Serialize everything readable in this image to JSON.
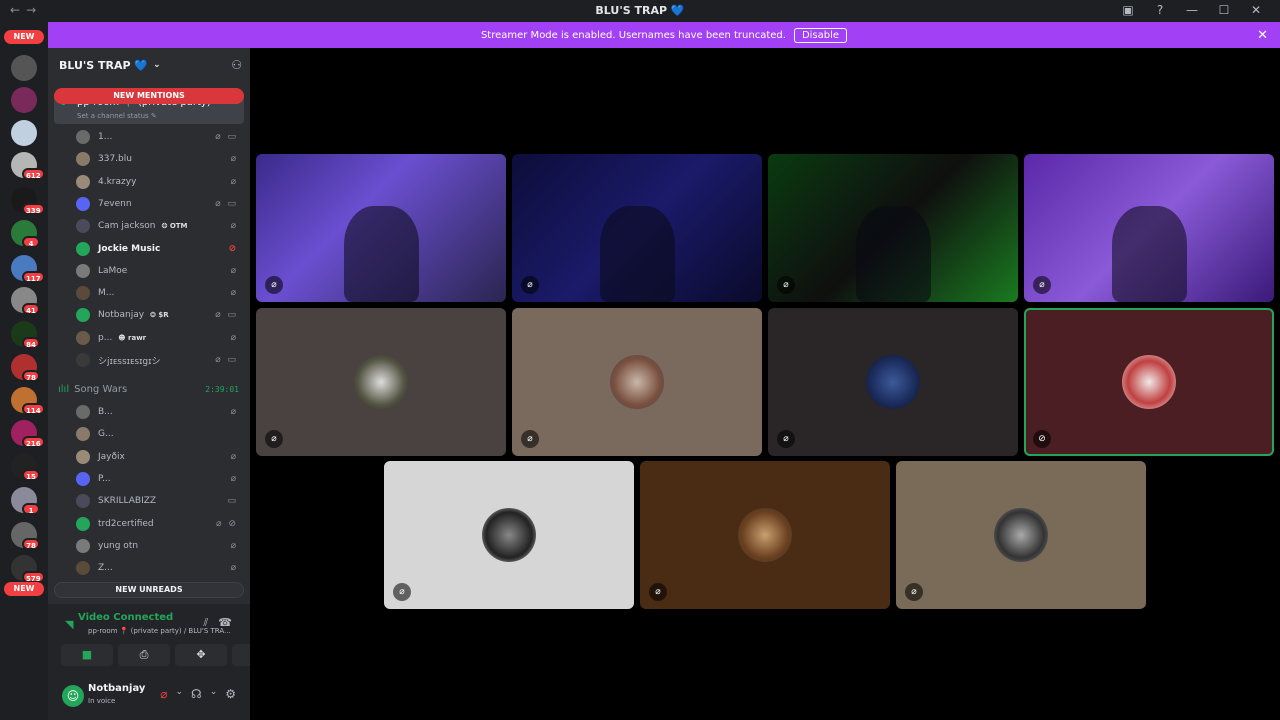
{
  "window": {
    "title": "BLU'S TRAP 💙",
    "nav_back": "←",
    "nav_fwd": "→"
  },
  "titlebar_icons": [
    "inbox-icon",
    "help-icon",
    "minimize-icon",
    "maximize-icon",
    "close-icon"
  ],
  "banner": {
    "text": "Streamer Mode is enabled. Usernames have been truncated.",
    "button": "Disable",
    "bg": "#a240f5"
  },
  "server_rail": {
    "top_pill": "NEW",
    "bottom_pill": "NEW",
    "badges": [
      "612",
      "339",
      "4",
      "117",
      "41",
      "84",
      "78",
      "114",
      "216",
      "15",
      "1",
      "78",
      "579"
    ]
  },
  "sidebar": {
    "server_name": "BLU'S TRAP 💙",
    "new_mentions": "NEW MENTIONS",
    "channel": {
      "name": "pp-room 📍 (private party)",
      "status": "Set a channel status ✎"
    },
    "members": [
      {
        "name": "1...",
        "icons": "⌀ ▭"
      },
      {
        "name": "337.blu",
        "icons": "⌀"
      },
      {
        "name": "4.krazyy",
        "icons": "⌀"
      },
      {
        "name": "7evenn",
        "icons": "⌀ ▭"
      },
      {
        "name": "Cam jackson",
        "tag": "❂ OTM",
        "icons": "⌀"
      },
      {
        "name": "Jockie Music",
        "icons": "⊘"
      },
      {
        "name": "LaMoe",
        "icons": "⌀"
      },
      {
        "name": "M...",
        "icons": "⌀"
      },
      {
        "name": "Notbanjay",
        "tag": "❂ $R",
        "icons": "⌀ ▭"
      },
      {
        "name": "p...",
        "tag": "☻ rawr",
        "icons": "⌀"
      },
      {
        "name": "シjɪᴇssɪᴇsɪgɪシ",
        "icons": "⌀ ▭"
      }
    ],
    "voice_channel": {
      "name": "Song Wars",
      "time": "2:39:01"
    },
    "members2": [
      {
        "name": "B...",
        "icons": "⌀"
      },
      {
        "name": "G...",
        "icons": ""
      },
      {
        "name": "Jayðix",
        "icons": "⌀"
      },
      {
        "name": "P...",
        "icons": "⌀"
      },
      {
        "name": "SKRILLABIZZ",
        "icons": "▭"
      },
      {
        "name": "trd2certified",
        "icons": "⌀ ⊘"
      },
      {
        "name": "yung otn",
        "icons": "⌀"
      },
      {
        "name": "Z...",
        "icons": "⌀"
      }
    ],
    "new_unreads": "NEW UNREADS"
  },
  "voice": {
    "status": "Video Connected",
    "location": "pp-room 📍 (private party) / BLU'S TRA...",
    "buttons": [
      "camera-icon",
      "screenshare-icon",
      "activities-icon",
      "soundboard-icon"
    ]
  },
  "user": {
    "name": "Notbanjay",
    "status": "In voice"
  },
  "tiles": [
    {
      "type": "video",
      "bg": "linear-gradient(135deg,#3b2a8a,#6a4fd0 40%,#2a2550)"
    },
    {
      "type": "video",
      "bg": "linear-gradient(135deg,#0d0d3a,#1a1a6a 50%,#0a0a2a)"
    },
    {
      "type": "video",
      "bg": "linear-gradient(135deg,#0a3a10,#0f0f0f 50%,#1a7a20)"
    },
    {
      "type": "video",
      "bg": "linear-gradient(135deg,#5a28a8,#8a5ad8 50%,#3a1a78)"
    },
    {
      "type": "avatar",
      "bg": "#4a4240",
      "avatar": "radial-gradient(circle,#ddd,#554 60%,#222)"
    },
    {
      "type": "avatar",
      "bg": "#7a6a5e",
      "avatar": "radial-gradient(circle,#c9b8a8,#7a5040 60%,#444)"
    },
    {
      "type": "avatar",
      "bg": "#2a2628",
      "avatar": "radial-gradient(circle,#3c5a9a,#1a2a5a 60%,#111)"
    },
    {
      "type": "avatar",
      "bg": "#4a1e22",
      "avatar": "radial-gradient(circle,#f0e8e8,#c04040 55%,#eee)",
      "speaking": true
    },
    {
      "type": "avatar",
      "bg": "#d6d6d6",
      "avatar": "radial-gradient(circle,#888,#222 60%,#eee)"
    },
    {
      "type": "avatar",
      "bg": "#4a2c14",
      "avatar": "radial-gradient(circle,#c8a070,#6a4020 60%,#332)"
    },
    {
      "type": "avatar",
      "bg": "#7a6a58",
      "avatar": "radial-gradient(circle,#aaa,#333 60%,#888)"
    }
  ]
}
